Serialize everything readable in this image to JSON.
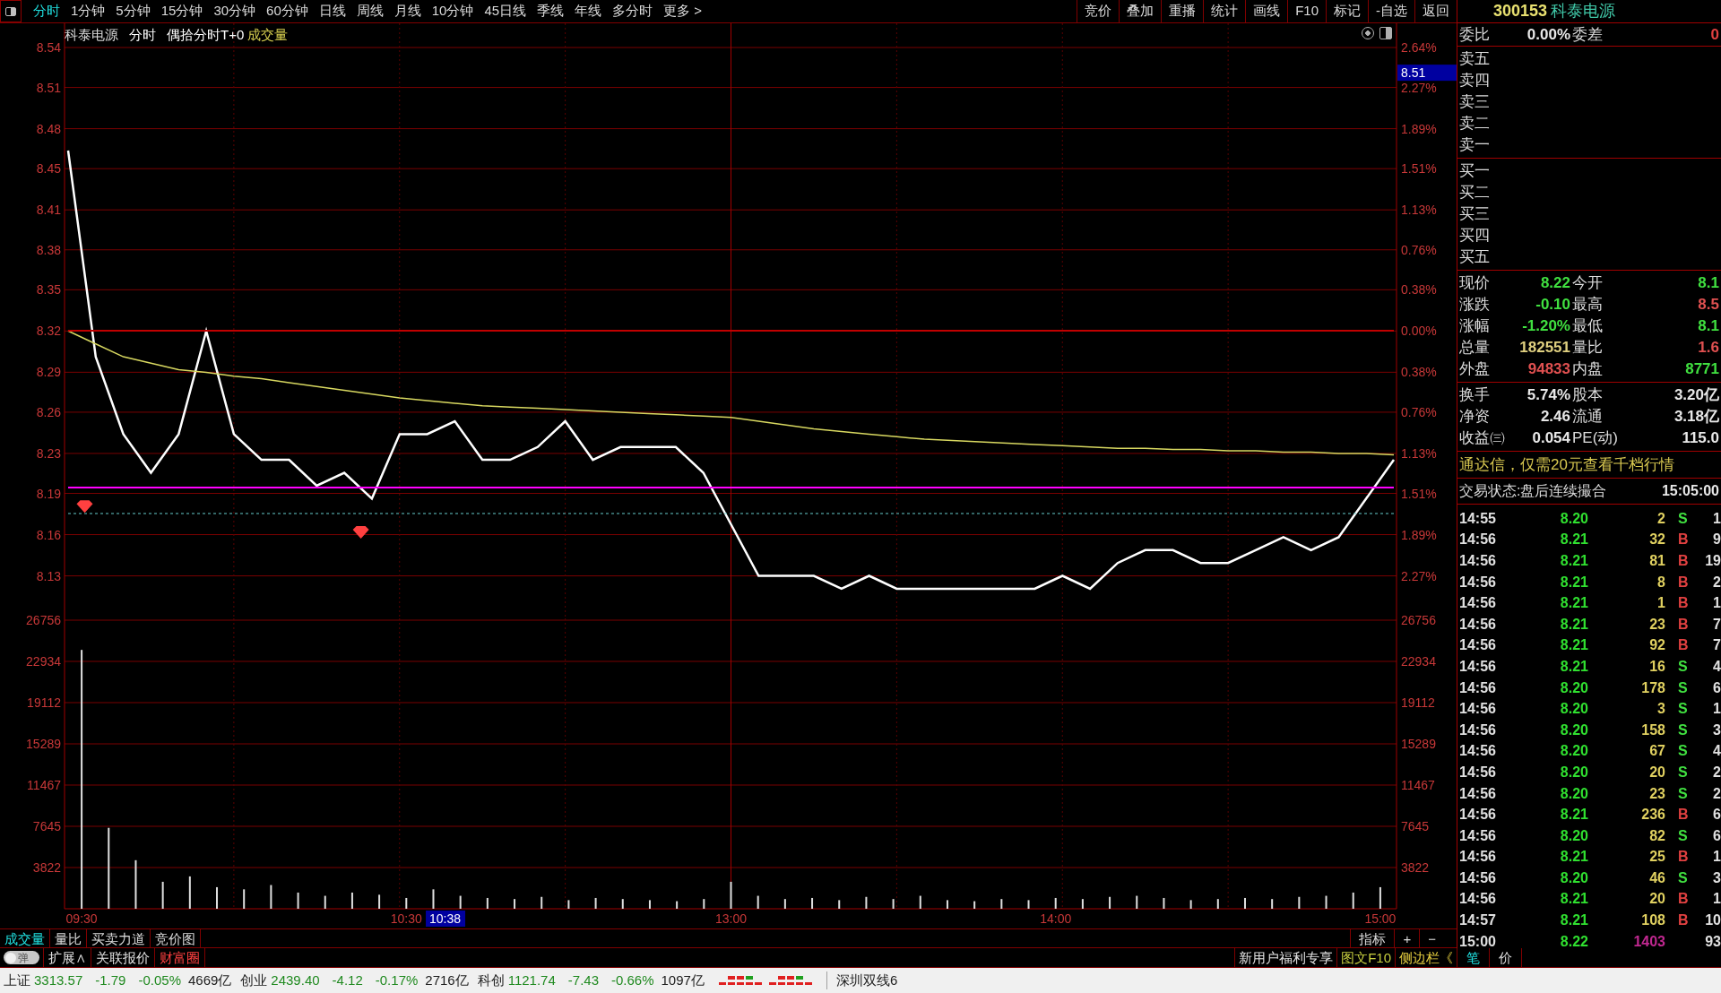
{
  "toolbar": {
    "periods": [
      {
        "label": "分时",
        "selected": true
      },
      {
        "label": "1分钟",
        "selected": false
      },
      {
        "label": "5分钟",
        "selected": false
      },
      {
        "label": "15分钟",
        "selected": false
      },
      {
        "label": "30分钟",
        "selected": false
      },
      {
        "label": "60分钟",
        "selected": false
      },
      {
        "label": "日线",
        "selected": false
      },
      {
        "label": "周线",
        "selected": false
      },
      {
        "label": "月线",
        "selected": false
      },
      {
        "label": "10分钟",
        "selected": false
      },
      {
        "label": "45日线",
        "selected": false
      },
      {
        "label": "季线",
        "selected": false
      },
      {
        "label": "年线",
        "selected": false
      },
      {
        "label": "多分时",
        "selected": false
      },
      {
        "label": "更多 >",
        "selected": false
      }
    ],
    "buttons": [
      "竞价",
      "叠加",
      "重播",
      "统计",
      "画线",
      "F10",
      "标记",
      "-自选",
      "返回"
    ]
  },
  "chart": {
    "title": {
      "name": "科泰电源",
      "mode": "分时",
      "indicator": "偶拾分时T+0",
      "sub": "成交量"
    },
    "right_axis_labels": [
      "2.64%",
      "2.27%",
      "1.89%",
      "1.51%",
      "1.13%",
      "0.76%",
      "0.38%",
      "0.00%",
      "0.38%",
      "0.76%",
      "1.13%",
      "1.51%",
      "1.89%",
      "2.27%"
    ],
    "cursor": {
      "time": "10:38",
      "price": "8.51"
    },
    "chart_data": {
      "type": "line",
      "grid": true,
      "ylim": [
        8.097,
        8.54
      ],
      "yticks": [
        {
          "value": 8.54,
          "label": "8.54"
        },
        {
          "value": 8.509,
          "label": "8.51"
        },
        {
          "value": 8.477,
          "label": "8.48"
        },
        {
          "value": 8.446,
          "label": "8.45"
        },
        {
          "value": 8.414,
          "label": "8.41"
        },
        {
          "value": 8.383,
          "label": "8.38"
        },
        {
          "value": 8.352,
          "label": "8.35"
        },
        {
          "value": 8.32,
          "label": "8.32"
        },
        {
          "value": 8.288,
          "label": "8.29"
        },
        {
          "value": 8.257,
          "label": "8.26"
        },
        {
          "value": 8.225,
          "label": "8.23"
        },
        {
          "value": 8.194,
          "label": "8.19"
        },
        {
          "value": 8.162,
          "label": "8.16"
        },
        {
          "value": 8.13,
          "label": "8.13"
        }
      ],
      "series": [
        {
          "color": "#ffffff",
          "values": [
            8.46,
            8.3,
            8.24,
            8.21,
            8.24,
            8.32,
            8.24,
            8.22,
            8.22,
            8.2,
            8.21,
            8.19,
            8.24,
            8.24,
            8.25,
            8.22,
            8.22,
            8.23,
            8.25,
            8.22,
            8.23,
            8.23,
            8.23,
            8.21,
            8.17,
            8.13,
            8.13,
            8.13,
            8.12,
            8.13,
            8.12,
            8.12,
            8.12,
            8.12,
            8.12,
            8.12,
            8.13,
            8.12,
            8.14,
            8.15,
            8.15,
            8.14,
            8.14,
            8.15,
            8.16,
            8.15,
            8.16,
            8.19,
            8.22
          ]
        },
        {
          "color": "#d8d860",
          "values": [
            8.32,
            8.31,
            8.3,
            8.295,
            8.29,
            8.288,
            8.285,
            8.283,
            8.28,
            8.277,
            8.274,
            8.271,
            8.268,
            8.266,
            8.264,
            8.262,
            8.261,
            8.26,
            8.259,
            8.258,
            8.257,
            8.256,
            8.255,
            8.254,
            8.253,
            8.25,
            8.247,
            8.244,
            8.242,
            8.24,
            8.238,
            8.236,
            8.235,
            8.234,
            8.233,
            8.232,
            8.231,
            8.23,
            8.229,
            8.229,
            8.228,
            8.228,
            8.227,
            8.227,
            8.226,
            8.226,
            8.225,
            8.225,
            8.224
          ]
        }
      ]
    }
  },
  "volume_chart": {
    "right_axis_labels": [
      "26756",
      "22934",
      "19112",
      "15289",
      "11467",
      "7645",
      "3822"
    ],
    "chart_data": {
      "type": "bar",
      "grid": true,
      "ylim": [
        0,
        26756
      ],
      "categories": [
        "09:30",
        null,
        null,
        null,
        null,
        null,
        null,
        null,
        null,
        null,
        null,
        null,
        "10:30",
        null,
        null,
        null,
        null,
        null,
        null,
        null,
        null,
        null,
        null,
        null,
        "13:00",
        null,
        null,
        null,
        null,
        null,
        null,
        null,
        null,
        null,
        null,
        null,
        "14:00",
        null,
        null,
        null,
        null,
        null,
        null,
        null,
        null,
        null,
        null,
        null,
        "15:00"
      ],
      "yticks": [
        {
          "value": 26756,
          "label": "26756"
        },
        {
          "value": 22934,
          "label": "22934"
        },
        {
          "value": 19112,
          "label": "19112"
        },
        {
          "value": 15289,
          "label": "15289"
        },
        {
          "value": 11467,
          "label": "11467"
        },
        {
          "value": 7645,
          "label": "7645"
        },
        {
          "value": 3822,
          "label": "3822"
        }
      ],
      "series": [
        {
          "color": "#e0e0e0",
          "values": [
            24000,
            7500,
            4500,
            2500,
            3000,
            2000,
            1800,
            2200,
            1500,
            1200,
            1500,
            1300,
            1000,
            1800,
            1200,
            1000,
            900,
            1100,
            800,
            1000,
            900,
            800,
            700,
            900,
            2500,
            1200,
            900,
            1000,
            800,
            1100,
            900,
            1200,
            800,
            700,
            900,
            800,
            1000,
            900,
            1100,
            1200,
            1000,
            800,
            900,
            1000,
            900,
            1100,
            1200,
            1500,
            2000
          ]
        }
      ]
    }
  },
  "bottom_tabs": [
    {
      "label": "成交量",
      "selected": true
    },
    {
      "label": "量比",
      "selected": false
    },
    {
      "label": "买卖力道",
      "selected": false
    },
    {
      "label": "竞价图",
      "selected": false
    }
  ],
  "indicator_controls": [
    "指标",
    "+",
    "−"
  ],
  "bottom_bar": {
    "toggle_label": "弹",
    "toggle_on": false,
    "items": [
      {
        "label": "扩展∧",
        "color": "#e0e0e0"
      },
      {
        "label": "关联报价",
        "color": "#e0e0e0"
      },
      {
        "label": "财富圈",
        "color": "#ff4040"
      }
    ],
    "right_links": [
      {
        "label": "新用户福利专享",
        "color": "#e0e0e0"
      },
      {
        "label": "图文F10",
        "color": "#c8d040"
      },
      {
        "label": "侧边栏《",
        "color": "#e8d040"
      }
    ],
    "panel_tabs": [
      {
        "label": "笔",
        "selected": true
      },
      {
        "label": "价",
        "selected": false
      }
    ]
  },
  "quote_panel": {
    "code": "300153",
    "name": "科泰电源",
    "weibi": {
      "cells": [
        {
          "label": "委比",
          "value": "0.00%",
          "color": "#e8e8e8"
        },
        {
          "label": "委差",
          "value": "0",
          "color": "#e04040"
        }
      ]
    },
    "asks": [
      "卖五",
      "卖四",
      "卖三",
      "卖二",
      "卖一"
    ],
    "bids": [
      "买一",
      "买二",
      "买三",
      "买四",
      "买五"
    ],
    "stats": [
      {
        "cells": [
          {
            "label": "现价",
            "value": "8.22",
            "color": "#40e040"
          },
          {
            "label": "今开",
            "value": "8.1",
            "color": "#40e040"
          }
        ]
      },
      {
        "cells": [
          {
            "label": "涨跌",
            "value": "-0.10",
            "color": "#40e040"
          },
          {
            "label": "最高",
            "value": "8.5",
            "color": "#e05050"
          }
        ]
      },
      {
        "cells": [
          {
            "label": "涨幅",
            "value": "-1.20%",
            "color": "#40e040"
          },
          {
            "label": "最低",
            "value": "8.1",
            "color": "#40e040"
          }
        ]
      },
      {
        "cells": [
          {
            "label": "总量",
            "value": "182551",
            "color": "#e0d080"
          },
          {
            "label": "量比",
            "value": "1.6",
            "color": "#e05050"
          }
        ]
      },
      {
        "cells": [
          {
            "label": "外盘",
            "value": "94833",
            "color": "#e05050"
          },
          {
            "label": "内盘",
            "value": "8771",
            "color": "#40e040"
          }
        ]
      }
    ],
    "fundamentals": [
      {
        "cells": [
          {
            "label": "换手",
            "value": "5.74%",
            "color": "#e8e8e8"
          },
          {
            "label": "股本",
            "value": "3.20亿",
            "color": "#e8e8e8"
          }
        ]
      },
      {
        "cells": [
          {
            "label": "净资",
            "value": "2.46",
            "color": "#e8e8e8"
          },
          {
            "label": "流通",
            "value": "3.18亿",
            "color": "#e8e8e8"
          }
        ]
      },
      {
        "cells": [
          {
            "label": "收益㈢",
            "value": "0.054",
            "color": "#e8e8e8"
          },
          {
            "label": "PE(动)",
            "value": "115.0",
            "color": "#e8e8e8"
          }
        ]
      }
    ],
    "ad": "通达信，仅需20元查看千档行情",
    "trade_status": {
      "label": "交易状态:盘后连续撮合",
      "time": "15:05:00"
    },
    "trades": [
      {
        "time": "14:55",
        "price": "8.20",
        "volume": {
          "text": "2",
          "color": "#e0d060"
        },
        "side": {
          "text": "S",
          "color": "#40e040"
        },
        "column_5": "1"
      },
      {
        "time": "14:56",
        "price": "8.21",
        "volume": {
          "text": "32",
          "color": "#e0d060"
        },
        "side": {
          "text": "B",
          "color": "#e04040"
        },
        "column_5": "9"
      },
      {
        "time": "14:56",
        "price": "8.21",
        "volume": {
          "text": "81",
          "color": "#e0d060"
        },
        "side": {
          "text": "B",
          "color": "#e04040"
        },
        "column_5": "19"
      },
      {
        "time": "14:56",
        "price": "8.21",
        "volume": {
          "text": "8",
          "color": "#e0d060"
        },
        "side": {
          "text": "B",
          "color": "#e04040"
        },
        "column_5": "2"
      },
      {
        "time": "14:56",
        "price": "8.21",
        "volume": {
          "text": "1",
          "color": "#e0d060"
        },
        "side": {
          "text": "B",
          "color": "#e04040"
        },
        "column_5": "1"
      },
      {
        "time": "14:56",
        "price": "8.21",
        "volume": {
          "text": "23",
          "color": "#e0d060"
        },
        "side": {
          "text": "B",
          "color": "#e04040"
        },
        "column_5": "7"
      },
      {
        "time": "14:56",
        "price": "8.21",
        "volume": {
          "text": "92",
          "color": "#e0d060"
        },
        "side": {
          "text": "B",
          "color": "#e04040"
        },
        "column_5": "7"
      },
      {
        "time": "14:56",
        "price": "8.21",
        "volume": {
          "text": "16",
          "color": "#e0d060"
        },
        "side": {
          "text": "S",
          "color": "#40e040"
        },
        "column_5": "4"
      },
      {
        "time": "14:56",
        "price": "8.20",
        "volume": {
          "text": "178",
          "color": "#e0d060"
        },
        "side": {
          "text": "S",
          "color": "#40e040"
        },
        "column_5": "6"
      },
      {
        "time": "14:56",
        "price": "8.20",
        "volume": {
          "text": "3",
          "color": "#e0d060"
        },
        "side": {
          "text": "S",
          "color": "#40e040"
        },
        "column_5": "1"
      },
      {
        "time": "14:56",
        "price": "8.20",
        "volume": {
          "text": "158",
          "color": "#e0d060"
        },
        "side": {
          "text": "S",
          "color": "#40e040"
        },
        "column_5": "3"
      },
      {
        "time": "14:56",
        "price": "8.20",
        "volume": {
          "text": "67",
          "color": "#e0d060"
        },
        "side": {
          "text": "S",
          "color": "#40e040"
        },
        "column_5": "4"
      },
      {
        "time": "14:56",
        "price": "8.20",
        "volume": {
          "text": "20",
          "color": "#e0d060"
        },
        "side": {
          "text": "S",
          "color": "#40e040"
        },
        "column_5": "2"
      },
      {
        "time": "14:56",
        "price": "8.20",
        "volume": {
          "text": "23",
          "color": "#e0d060"
        },
        "side": {
          "text": "S",
          "color": "#40e040"
        },
        "column_5": "2"
      },
      {
        "time": "14:56",
        "price": "8.21",
        "volume": {
          "text": "236",
          "color": "#e0d060"
        },
        "side": {
          "text": "B",
          "color": "#e04040"
        },
        "column_5": "6"
      },
      {
        "time": "14:56",
        "price": "8.20",
        "volume": {
          "text": "82",
          "color": "#e0d060"
        },
        "side": {
          "text": "S",
          "color": "#40e040"
        },
        "column_5": "6"
      },
      {
        "time": "14:56",
        "price": "8.21",
        "volume": {
          "text": "25",
          "color": "#e0d060"
        },
        "side": {
          "text": "B",
          "color": "#e04040"
        },
        "column_5": "1"
      },
      {
        "time": "14:56",
        "price": "8.20",
        "volume": {
          "text": "46",
          "color": "#e0d060"
        },
        "side": {
          "text": "S",
          "color": "#40e040"
        },
        "column_5": "3"
      },
      {
        "time": "14:56",
        "price": "8.21",
        "volume": {
          "text": "20",
          "color": "#e0d060"
        },
        "side": {
          "text": "B",
          "color": "#e04040"
        },
        "column_5": "1"
      },
      {
        "time": "14:57",
        "price": "8.21",
        "volume": {
          "text": "108",
          "color": "#e0d060"
        },
        "side": {
          "text": "B",
          "color": "#e04040"
        },
        "column_5": "10"
      },
      {
        "time": "15:00",
        "price": "8.22",
        "volume": {
          "text": "1403",
          "color": "#c02890"
        },
        "column_5": "93"
      }
    ]
  },
  "status_bar": {
    "indices": [
      {
        "name": "上证",
        "price": "3313.57",
        "change": "-1.79",
        "pct": "-0.05%",
        "amount": "4669亿"
      },
      {
        "name": "创业",
        "price": "2439.40",
        "change": "-4.12",
        "pct": "-0.17%",
        "amount": "2716亿"
      },
      {
        "name": "科创",
        "price": "1121.74",
        "change": "-7.43",
        "pct": "-0.66%",
        "amount": "1097亿"
      }
    ],
    "line": "深圳双线6"
  }
}
